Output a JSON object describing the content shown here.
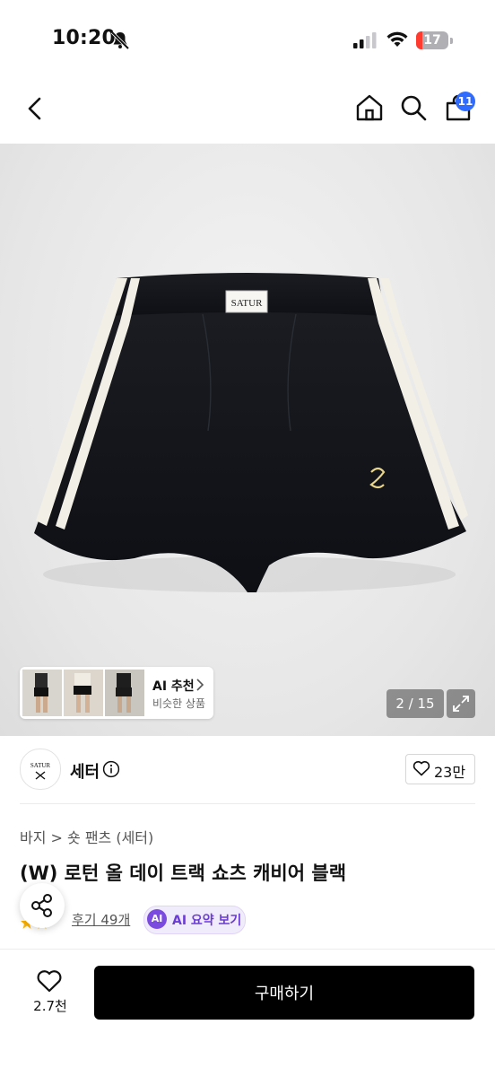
{
  "status_bar": {
    "time": "10:20",
    "battery": "17"
  },
  "nav": {
    "cart_count": "11"
  },
  "gallery": {
    "shorts_label": "SATUR",
    "ai_recommend_title": "AI 추천",
    "ai_recommend_subtitle": "비슷한 상품",
    "page_counter": "2 / 15"
  },
  "brand": {
    "logo_text": "SATUR",
    "name": "세터",
    "like_count": "23만"
  },
  "product": {
    "breadcrumb": "바지 > 숏 팬츠 (세터)",
    "title": "(W) 로턴 올 데이 트랙 쇼츠 캐비어 블랙",
    "review_link": "후기 49개",
    "ai_badge": "AI",
    "ai_summary_label": "AI 요약 보기"
  },
  "bottom_bar": {
    "wish_count": "2.7천",
    "buy_label": "구매하기"
  },
  "colors": {
    "accent_blue": "#2f6bff",
    "ai_purple": "#7b4be0",
    "buy_black": "#000000"
  }
}
